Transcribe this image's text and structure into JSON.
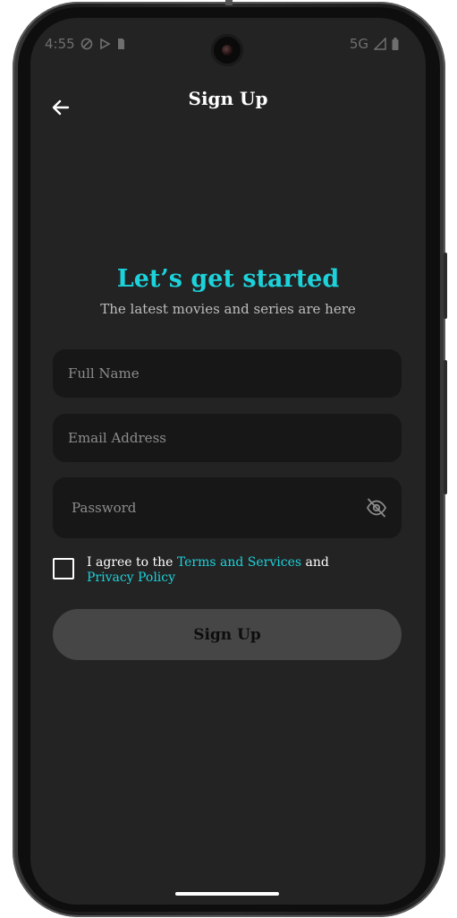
{
  "status_bar": {
    "time": "4:55",
    "network": "5G"
  },
  "header": {
    "title": "Sign Up",
    "back_icon": "arrow-left-icon"
  },
  "hero": {
    "title": "Let’s get started",
    "subtitle": "The latest movies and series are here"
  },
  "form": {
    "full_name_placeholder": "Full Name",
    "email_placeholder": "Email Address",
    "password_placeholder": "Password",
    "password_toggle_icon": "eye-off-icon"
  },
  "agreement": {
    "prefix": "I agree to the ",
    "terms_link": "Terms and Services",
    "middle": " and ",
    "privacy_link": "Privacy Policy",
    "checked": false
  },
  "submit": {
    "label": "Sign Up"
  },
  "colors": {
    "accent": "#1cd2db",
    "background": "#232323",
    "field_background": "#171717",
    "button_background": "#464646"
  }
}
